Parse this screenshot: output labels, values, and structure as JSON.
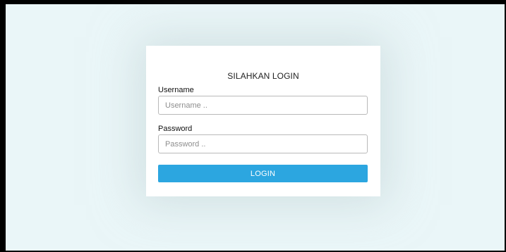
{
  "login": {
    "title": "SILAHKAN LOGIN",
    "username_label": "Username",
    "username_placeholder": "Username ..",
    "username_value": "",
    "password_label": "Password",
    "password_placeholder": "Password ..",
    "password_value": "",
    "button_label": "LOGIN"
  },
  "colors": {
    "page_background": "#eaf6f8",
    "card_background": "#ffffff",
    "button_accent": "#2ca6e0"
  }
}
